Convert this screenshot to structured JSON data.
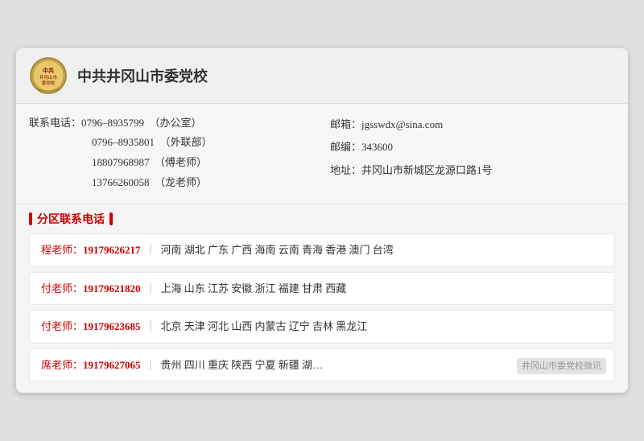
{
  "header": {
    "org_name": "中共井冈山市委党校"
  },
  "contact": {
    "phone_label": "联系电话：",
    "phones": [
      {
        "number": "0796–8935799",
        "note": "（办公室）"
      },
      {
        "number": "0796–8935801",
        "note": "（外联部）"
      },
      {
        "number": "18807968987",
        "note": "（傅老师）"
      },
      {
        "number": "13766260058",
        "note": "（龙老师）"
      }
    ],
    "email_label": "邮箱：",
    "email": "jgsswdx@sina.com",
    "zip_label": "邮编：",
    "zip": "343600",
    "address_label": "地址：",
    "address": "井冈山市新城区龙源口路1号"
  },
  "section_title": "分区联系电话",
  "districts": [
    {
      "teacher": "程老师：",
      "phone": "19179626217",
      "regions": "河南  湖北  广东  广西  海南  云南  青海  香港  澳门  台湾"
    },
    {
      "teacher": "付老师：",
      "phone": "19179621820",
      "regions": "上海  山东  江苏  安徽  浙江  福建  甘肃  西藏"
    },
    {
      "teacher": "付老师：",
      "phone": "19179623685",
      "regions": "北京  天津  河北  山西  内蒙古  辽宁  吉林  黑龙江"
    },
    {
      "teacher": "席老师：",
      "phone": "19179627065",
      "regions": "贵州  四川  重庆  陕西  宁夏  新疆  湖…"
    }
  ],
  "watermark": "井冈山市委党校微讯"
}
